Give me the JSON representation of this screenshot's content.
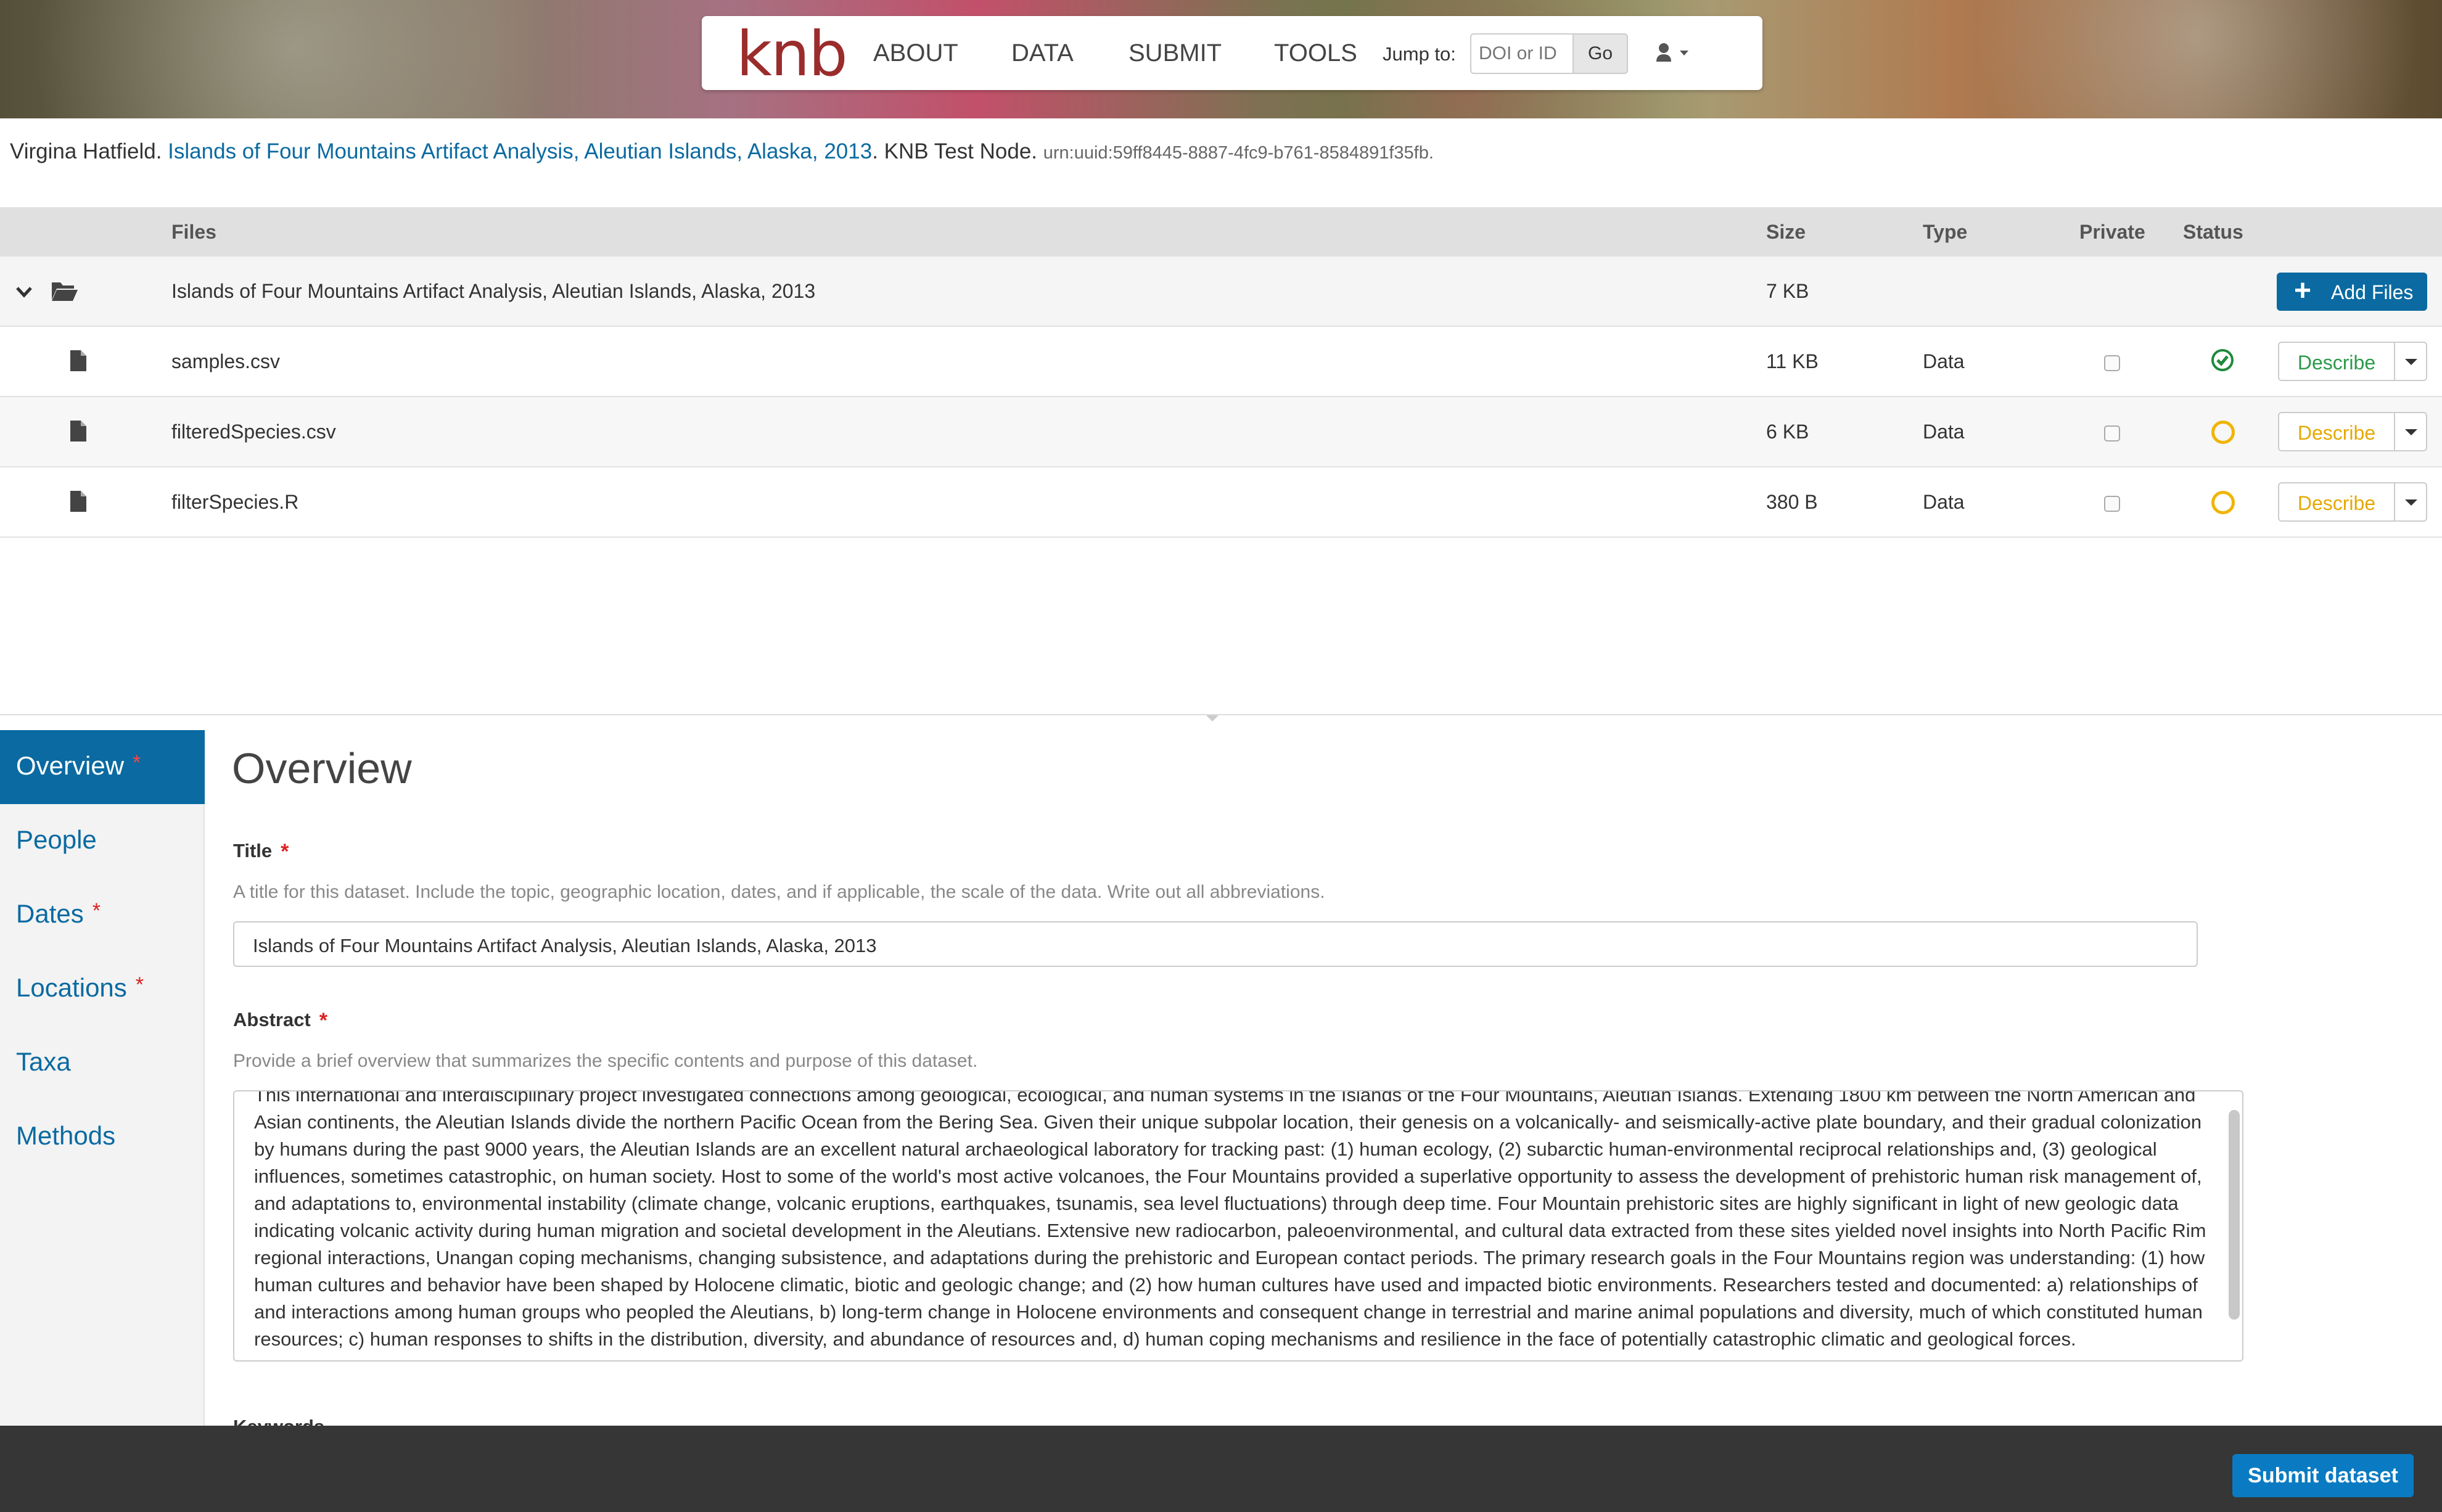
{
  "nav": {
    "logo": "knb",
    "links": [
      "ABOUT",
      "DATA",
      "SUBMIT",
      "TOOLS"
    ],
    "jump_label": "Jump to:",
    "jump_placeholder": "DOI or ID",
    "go_label": "Go",
    "user_icon": "user-icon"
  },
  "citation": {
    "author": "Virgina Hatfield.",
    "title": "Islands of Four Mountains Artifact Analysis, Aleutian Islands, Alaska, 2013",
    "node": ". KNB Test Node.",
    "urn": "urn:uuid:59ff8445-8887-4fc9-b761-8584891f35fb."
  },
  "files_table": {
    "headers": {
      "files": "Files",
      "size": "Size",
      "type": "Type",
      "private": "Private",
      "status": "Status"
    },
    "folder": {
      "name": "Islands of Four Mountains Artifact Analysis, Aleutian Islands, Alaska, 2013",
      "size": "7 KB"
    },
    "add_files_label": "Add Files",
    "rows": [
      {
        "name": "samples.csv",
        "size": "11 KB",
        "type": "Data",
        "status": "complete",
        "describe": "Describe"
      },
      {
        "name": "filteredSpecies.csv",
        "size": "6 KB",
        "type": "Data",
        "status": "pending",
        "describe": "Describe"
      },
      {
        "name": "filterSpecies.R",
        "size": "380 B",
        "type": "Data",
        "status": "pending",
        "describe": "Describe"
      }
    ]
  },
  "sidebar": {
    "items": [
      {
        "label": "Overview",
        "required": "*"
      },
      {
        "label": "People",
        "required": ""
      },
      {
        "label": "Dates",
        "required": "*"
      },
      {
        "label": "Locations",
        "required": "*"
      },
      {
        "label": "Taxa",
        "required": ""
      },
      {
        "label": "Methods",
        "required": ""
      }
    ]
  },
  "editor": {
    "heading": "Overview",
    "title_label": "Title",
    "title_help": "A title for this dataset. Include the topic, geographic location, dates, and if applicable, the scale of the data. Write out all abbreviations.",
    "title_value": "Islands of Four Mountains Artifact Analysis, Aleutian Islands, Alaska, 2013",
    "abstract_label": "Abstract",
    "abstract_help": "Provide a brief overview that summarizes the specific contents and purpose of this dataset.",
    "abstract_value": "This international and interdisciplinary project investigated connections among geological, ecological, and human systems in the Islands of the Four Mountains, Aleutian Islands. Extending 1800 km between the North American and Asian continents, the Aleutian Islands divide the northern Pacific Ocean from the Bering Sea. Given their unique subpolar location, their genesis on a volcanically- and seismically-active plate boundary, and their gradual colonization by humans during the past 9000 years, the Aleutian Islands are an excellent natural archaeological laboratory for tracking past: (1) human ecology, (2) subarctic human-environmental reciprocal relationships and, (3) geological influences, sometimes catastrophic, on human society. Host to some of the world's most active volcanoes, the Four Mountains provided a superlative opportunity to assess the development of prehistoric human risk management of, and adaptations to, environmental instability (climate change, volcanic eruptions, earthquakes, tsunamis, sea level fluctuations) through deep time. Four Mountain prehistoric sites are highly significant in light of new geologic data indicating volcanic activity during human migration and societal development in the Aleutians. Extensive new radiocarbon, paleoenvironmental, and cultural data extracted from these sites yielded novel insights into North Pacific Rim regional interactions, Unangan coping mechanisms, changing subsistence, and adaptations during the prehistoric and European contact periods. The primary research goals in the Four Mountains region was understanding: (1) how human cultures and behavior have been shaped by Holocene climatic, biotic and geologic change; and (2) how human cultures have used and impacted biotic environments. Researchers tested and documented: a) relationships of and interactions among human groups who peopled the Aleutians, b) long-term change in Holocene environments and consequent change in terrestrial and marine animal populations and diversity, much of which constituted human resources; c) human responses to shifts in the distribution, diversity, and abundance of resources and, d) human coping mechanisms and resilience in the face of potentially catastrophic climatic and geological forces.",
    "keywords_label": "Keywords"
  },
  "footer": {
    "submit_label": "Submit dataset"
  },
  "colors": {
    "primary": "#0a6aa1",
    "success": "#2b9a4a",
    "warning": "#f0b400",
    "required": "#d22222"
  }
}
